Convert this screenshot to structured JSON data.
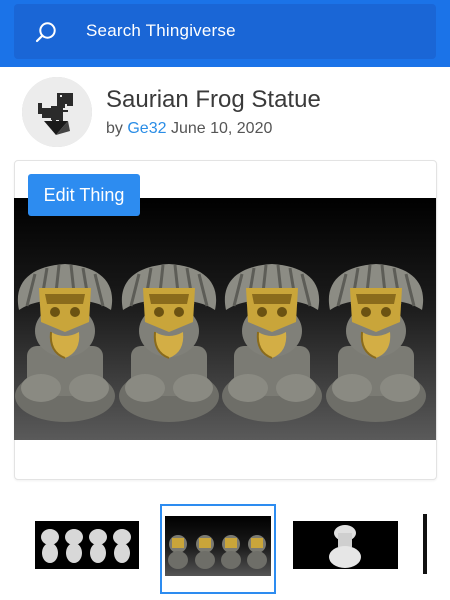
{
  "search": {
    "placeholder": "Search Thingiverse"
  },
  "thing": {
    "title": "Saurian Frog Statue",
    "by_prefix": "by",
    "author": "Ge32",
    "date": "June 10, 2020"
  },
  "actions": {
    "edit_label": "Edit Thing"
  },
  "colors": {
    "header": "#1b73e8",
    "accent": "#2d8cf0",
    "author_link": "#2a8de6"
  },
  "thumbnails": {
    "selected_index": 1,
    "count": 4
  }
}
